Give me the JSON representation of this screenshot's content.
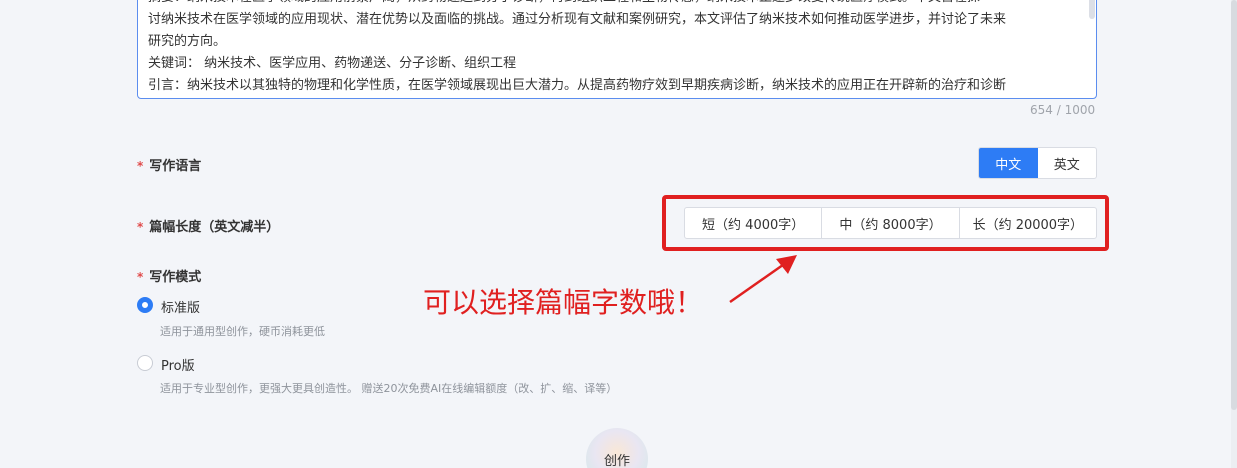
{
  "editor": {
    "lines": [
      "摘要：纳米技术在医学领域的应用前景广阔，从药物递送到分子诊断，再到组织工程和生物传感，纳米技术正逐步改变传统医疗模式。本文旨在探",
      "讨纳米技术在医学领域的应用现状、潜在优势以及面临的挑战。通过分析现有文献和案例研究，本文评估了纳米技术如何推动医学进步，并讨论了未来",
      "研究的方向。",
      "关键词： 纳米技术、医学应用、药物递送、分子诊断、组织工程",
      "引言：纳米技术以其独特的物理和化学性质，在医学领域展现出巨大潜力。从提高药物疗效到早期疾病诊断，纳米技术的应用正在开辟新的治疗和诊断"
    ],
    "char_count": "654 / 1000"
  },
  "language": {
    "required_mark": "*",
    "label": "写作语言",
    "options": [
      "中文",
      "英文"
    ],
    "selected": "中文"
  },
  "length": {
    "required_mark": "*",
    "label": "篇幅长度（英文减半）",
    "options": [
      "短（约 4000字）",
      "中（约 8000字）",
      "长（约 20000字）"
    ]
  },
  "annotation": {
    "text": "可以选择篇幅字数哦！",
    "color": "#e02020"
  },
  "mode": {
    "required_mark": "*",
    "label": "写作模式",
    "options": [
      {
        "label": "标准版",
        "desc": "适用于通用型创作，硬币消耗更低",
        "checked": true
      },
      {
        "label": "Pro版",
        "desc": "适用于专业型创作，更强大更具创造性。 赠送20次免费AI在线编辑额度（改、扩、缩、译等）",
        "checked": false
      }
    ]
  },
  "create_button": "创作",
  "colors": {
    "accent": "#2d7cf5",
    "required": "#e04a4a"
  }
}
